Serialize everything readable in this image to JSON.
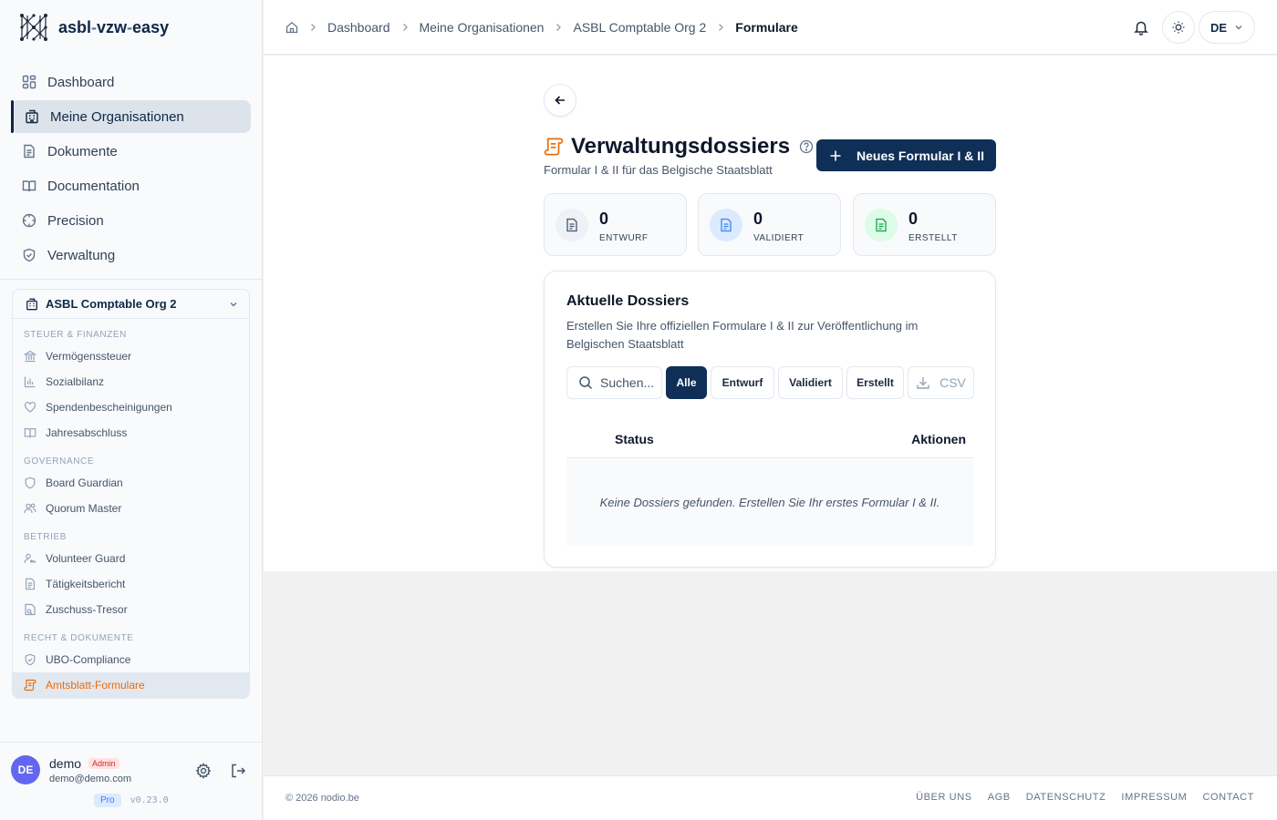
{
  "brand": {
    "name_part1": "asbl",
    "dash1": "-",
    "name_part2": "vzw",
    "dash2": "-",
    "name_part3": "easy",
    "logo_icon": "network-logo"
  },
  "sidebar": {
    "main_nav": [
      {
        "label": "Dashboard",
        "icon": "grid-icon",
        "active": false
      },
      {
        "label": "Meine Organisationen",
        "icon": "building-icon",
        "active": true
      },
      {
        "label": "Dokumente",
        "icon": "document-icon",
        "active": false
      },
      {
        "label": "Documentation",
        "icon": "book-icon",
        "active": false
      },
      {
        "label": "Precision",
        "icon": "crosshair-icon",
        "active": false
      },
      {
        "label": "Verwaltung",
        "icon": "shield-icon",
        "active": false
      }
    ],
    "org": {
      "name": "ASBL Comptable Org 2",
      "sections": [
        {
          "title": "STEUER & FINANZEN",
          "items": [
            {
              "label": "Vermögenssteuer",
              "icon": "bank-icon"
            },
            {
              "label": "Sozialbilanz",
              "icon": "bar-chart-icon"
            },
            {
              "label": "Spendenbescheinigungen",
              "icon": "heart-icon"
            },
            {
              "label": "Jahresabschluss",
              "icon": "book-icon"
            }
          ]
        },
        {
          "title": "GOVERNANCE",
          "items": [
            {
              "label": "Board Guardian",
              "icon": "shield-icon"
            },
            {
              "label": "Quorum Master",
              "icon": "users-icon"
            }
          ]
        },
        {
          "title": "BETRIEB",
          "items": [
            {
              "label": "Volunteer Guard",
              "icon": "user-key-icon"
            },
            {
              "label": "Tätigkeitsbericht",
              "icon": "document-icon"
            },
            {
              "label": "Zuschuss-Tresor",
              "icon": "vault-icon"
            }
          ]
        },
        {
          "title": "RECHT & DOKUMENTE",
          "items": [
            {
              "label": "UBO-Compliance",
              "icon": "shield-check-icon"
            },
            {
              "label": "Amtsblatt-Formulare",
              "icon": "scroll-icon",
              "active": true
            }
          ]
        }
      ]
    },
    "user": {
      "initials": "DE",
      "name": "demo",
      "role": "Admin",
      "email": "demo@demo.com",
      "plan": "Pro",
      "version": "v0.23.0"
    }
  },
  "topbar": {
    "breadcrumbs": [
      "Dashboard",
      "Meine Organisationen",
      "ASBL Comptable Org 2"
    ],
    "current": "Formulare",
    "language": "DE"
  },
  "page": {
    "title": "Verwaltungsdossiers",
    "subtitle": "Formular I & II für das Belgische Staatsblatt",
    "new_button": "Neues Formular I & II",
    "stats": [
      {
        "value": "0",
        "label": "ENTWURF",
        "icon": "document-icon",
        "color": "#475569",
        "bg": "#eef2f6"
      },
      {
        "value": "0",
        "label": "VALIDIERT",
        "icon": "document-icon",
        "color": "#3b82f6",
        "bg": "#dbeafe"
      },
      {
        "value": "0",
        "label": "ERSTELLT",
        "icon": "document-icon",
        "color": "#16a34a",
        "bg": "#dcfce7"
      }
    ],
    "card": {
      "title": "Aktuelle Dossiers",
      "description": "Erstellen Sie Ihre offiziellen Formulare I & II zur Veröffentlichung im Belgischen Staatsblatt",
      "search_placeholder": "Suchen...",
      "filters": [
        "Alle",
        "Entwurf",
        "Validiert",
        "Erstellt"
      ],
      "active_filter": "Alle",
      "csv_label": "CSV",
      "columns": {
        "status": "Status",
        "actions": "Aktionen"
      },
      "empty_message": "Keine Dossiers gefunden. Erstellen Sie Ihr erstes Formular I & II."
    }
  },
  "footer": {
    "copyright": "© 2026 nodio.be",
    "links": [
      "ÜBER UNS",
      "AGB",
      "DATENSCHUTZ",
      "IMPRESSUM",
      "CONTACT"
    ]
  },
  "colors": {
    "brand": "#0f2747",
    "button": "#0f2f57",
    "accent_orange": "#ea6c0a",
    "avatar": "#6366f1"
  }
}
